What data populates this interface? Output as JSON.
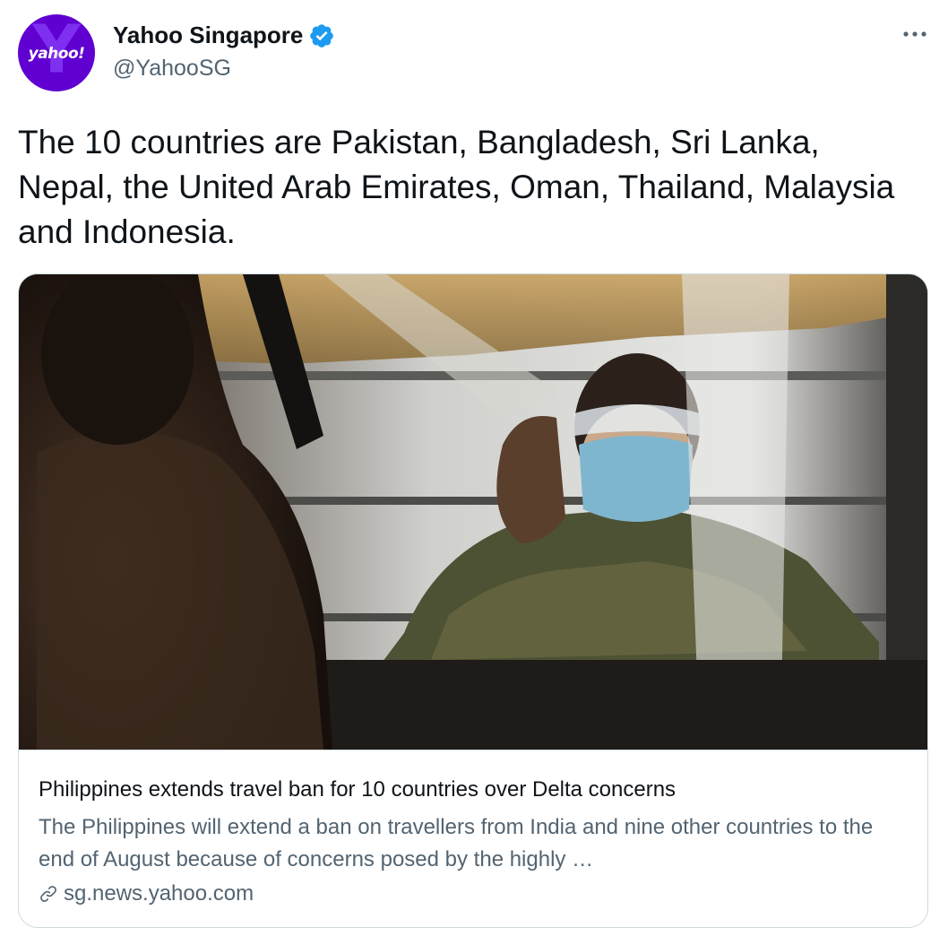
{
  "author": {
    "avatar_text": "yahoo!",
    "display_name": "Yahoo Singapore",
    "handle": "@YahooSG",
    "verified": true,
    "verified_icon": "verified-badge-icon"
  },
  "more_icon": "more-options-icon",
  "tweet": {
    "text": "The 10 countries are Pakistan, Bangladesh, Sri Lanka, Nepal, the United Arab Emirates, Oman, Thailand, Malaysia and Indonesia."
  },
  "card": {
    "title": "Philippines extends travel ban for 10 countries over Delta concerns",
    "description": "The Philippines will extend a ban on travellers from India and nine other countries to the end of August because of concerns posed by the highly …",
    "domain": "sg.news.yahoo.com",
    "link_icon": "link-icon"
  },
  "colors": {
    "accent": "#1d9bf0",
    "avatar_bg": "#6001d2",
    "secondary_text": "#536471",
    "border": "#cfd9de"
  }
}
